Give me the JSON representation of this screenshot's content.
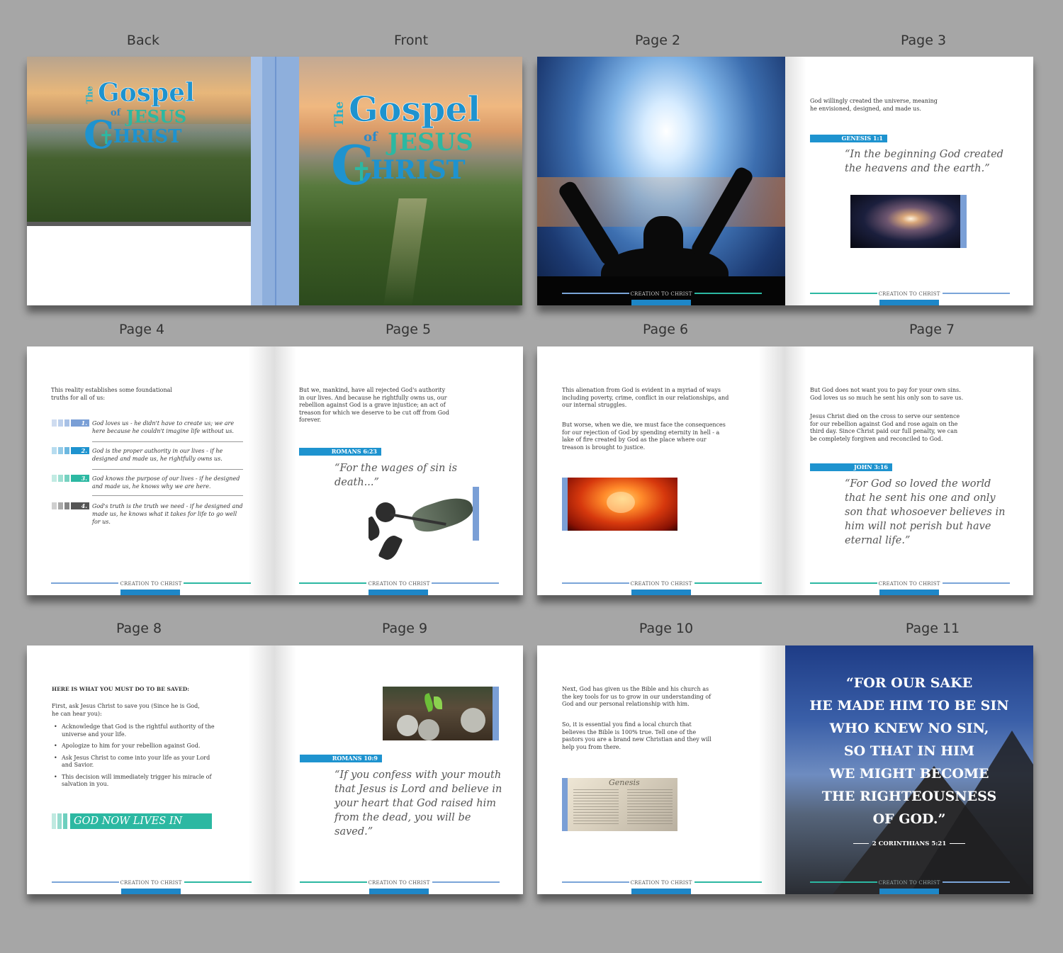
{
  "labels": {
    "back": "Back",
    "front": "Front",
    "p2": "Page 2",
    "p3": "Page 3",
    "p4": "Page 4",
    "p5": "Page 5",
    "p6": "Page 6",
    "p7": "Page 7",
    "p8": "Page 8",
    "p9": "Page 9",
    "p10": "Page 10",
    "p11": "Page 11"
  },
  "cover": {
    "the": "The",
    "gospel": "Gospel",
    "of": "of",
    "jesus": "JESUS",
    "christ_c": "C",
    "christ_rest": "HRIST"
  },
  "footer_text": "CREATION TO CHRIST",
  "p3": {
    "body": "God willingly created the universe, meaning he envisioned, designed, and made us.",
    "tag": "GENESIS 1:1",
    "quote": "“In the beginning God created the heavens and the earth.”"
  },
  "p4": {
    "intro": "This reality establishes some foundational truths for all of us:",
    "items": [
      {
        "num": "1.",
        "text": "God loves us - he didn't have to create us; we are here because he couldn't imagine life without us."
      },
      {
        "num": "2.",
        "text": "God is the proper authority in our lives - if he designed and made us, he rightfully owns us."
      },
      {
        "num": "3.",
        "text": "God knows the purpose of our lives - if he designed and made us, he knows why we are here."
      },
      {
        "num": "4.",
        "text": "God's truth is the truth we need - if he designed and made us, he knows what it takes for life to go well for us."
      }
    ]
  },
  "p5": {
    "body": "But we, mankind, have all rejected God's authority in our lives. And because he rightfully owns us, our rebellion against God is a grave injustice; an act of treason for which we deserve to be cut off from God forever.",
    "tag": "ROMANS 6:23",
    "quote": "“For the wages of sin is death...”"
  },
  "p6": {
    "body1": "This alienation from God is evident in a myriad of ways including poverty, crime, conflict in our relationships, and our internal struggles.",
    "body2": "But worse, when we die, we must face the consequences for our rejection of God by spending eternity in hell - a lake of fire created by God as the place where our treason is brought to justice."
  },
  "p7": {
    "body1": "But God does not want you to pay for your own sins. God loves us so much he sent his only son to save us.",
    "body2": "Jesus Christ died on the cross to serve our sentence for our rebellion against God and rose again on the third day. Since Christ paid our full penalty, we can be completely forgiven and reconciled to God.",
    "tag": "JOHN 3:16",
    "quote": "“For God so loved the world that he sent his one and only son that whosoever believes in him will not perish but have eternal life.”"
  },
  "p8": {
    "heading": "HERE IS WHAT YOU MUST DO TO BE SAVED:",
    "intro": "First, ask Jesus Christ to save you (Since he is God, he can hear you):",
    "bullets": [
      "Acknowledge that God is the rightful authority of the universe and your life.",
      "Apologize to him for your rebellion against God.",
      "Ask Jesus Christ to come into your life as your Lord and Savior.",
      "This decision will immediately trigger his miracle of salvation in you."
    ],
    "banner": "GOD NOW LIVES IN YOU!"
  },
  "p9": {
    "tag": "ROMANS 10:9",
    "quote": "“If you confess with your mouth that Jesus is Lord and believe in your heart that God raised him from the dead, you will be saved.”"
  },
  "p10": {
    "body1": "Next, God has given us the Bible and his church as the key tools for us to grow in our understanding of God and our personal relationship with him.",
    "body2": "So, it is essential you find a local church that believes the Bible is 100% true. Tell one of the pastors you are a brand new Christian and they will help you from there.",
    "bible_word": "Genesis"
  },
  "p11": {
    "quote_lines": [
      "“FOR OUR SAKE",
      "HE MADE HIM TO BE SIN",
      "WHO KNEW NO SIN,",
      "SO THAT IN HIM",
      "WE MIGHT BECOME",
      "THE RIGHTEOUSNESS",
      "OF GOD.”"
    ],
    "ref": "2 CORINTHIANS 5:21"
  },
  "colors": {
    "accent_blue": "#1e93cf",
    "accent_teal": "#2cb8a2",
    "accent_lightblue": "#7a9fd6",
    "background": "#a6a6a6"
  }
}
